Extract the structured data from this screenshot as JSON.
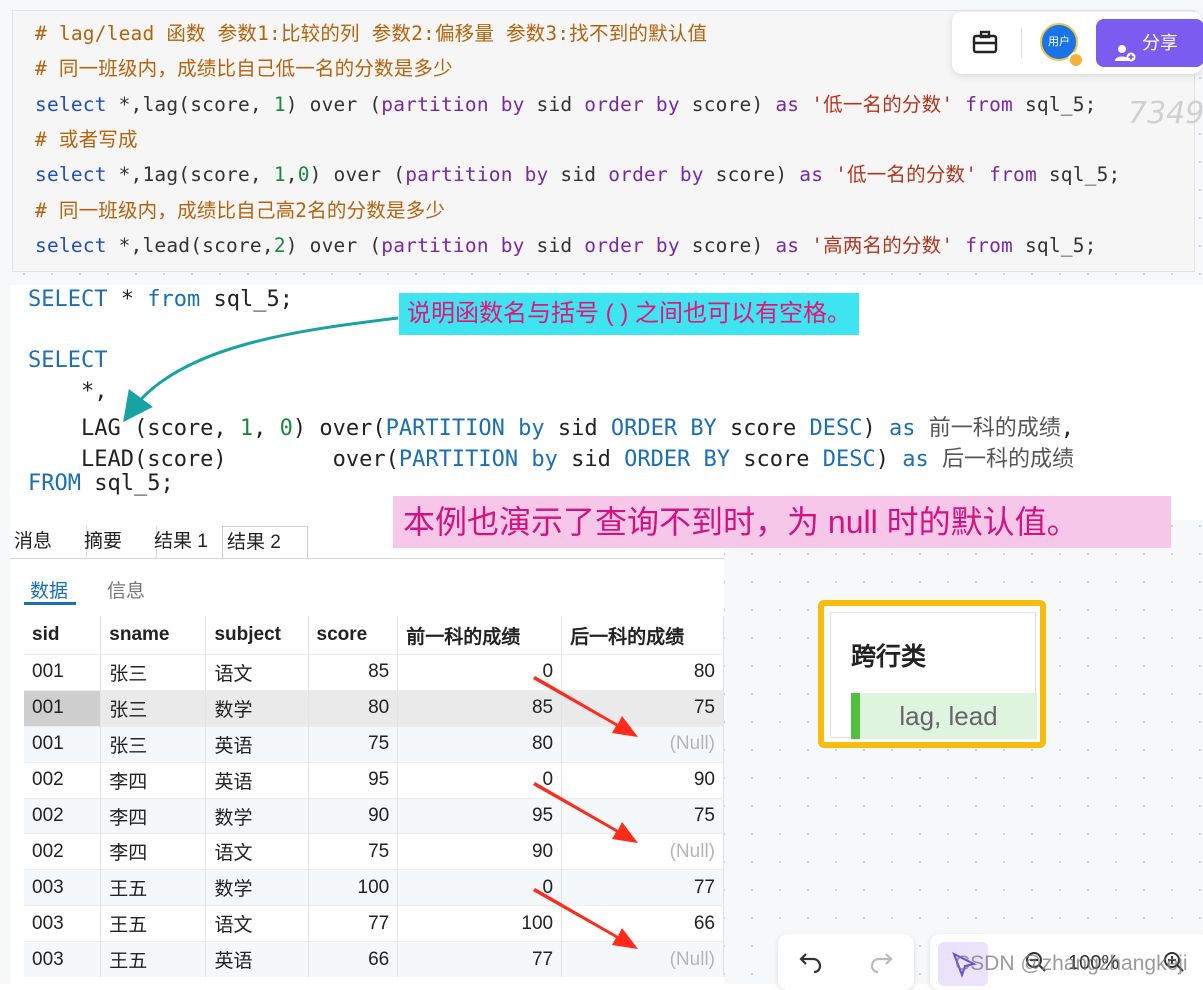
{
  "top_code": {
    "lines": [
      {
        "parts": [
          [
            "c-cmt",
            "# lag/lead 函数 参数1:比较的列 参数2:偏移量 参数3:找不到的默认值"
          ]
        ]
      },
      {
        "parts": [
          [
            "c-cmt",
            "# 同一班级内，成绩比自己低一名的分数是多少"
          ]
        ]
      },
      {
        "parts": [
          [
            "c-kw",
            "select"
          ],
          [
            "c-plain",
            " *,lag(score, "
          ],
          [
            "c-num",
            "1"
          ],
          [
            "c-plain",
            ") over ("
          ],
          [
            "c-purple",
            "partition by"
          ],
          [
            "c-plain",
            " sid "
          ],
          [
            "c-purple",
            "order by"
          ],
          [
            "c-plain",
            " score) "
          ],
          [
            "c-purple",
            "as"
          ],
          [
            "c-plain",
            " "
          ],
          [
            "c-str",
            "'低一名的分数'"
          ],
          [
            "c-plain",
            " "
          ],
          [
            "c-purple",
            "from"
          ],
          [
            "c-plain",
            " sql_5;"
          ]
        ]
      },
      {
        "parts": [
          [
            "c-cmt",
            "# 或者写成"
          ]
        ]
      },
      {
        "parts": [
          [
            "c-kw",
            "select"
          ],
          [
            "c-plain",
            " *,1ag(score, "
          ],
          [
            "c-num",
            "1"
          ],
          [
            "c-plain",
            ","
          ],
          [
            "c-num",
            "0"
          ],
          [
            "c-plain",
            ") over ("
          ],
          [
            "c-purple",
            "partition by"
          ],
          [
            "c-plain",
            " sid "
          ],
          [
            "c-purple",
            "order by"
          ],
          [
            "c-plain",
            " score) "
          ],
          [
            "c-purple",
            "as"
          ],
          [
            "c-plain",
            " "
          ],
          [
            "c-str",
            "'低一名的分数'"
          ],
          [
            "c-plain",
            " "
          ],
          [
            "c-purple",
            "from"
          ],
          [
            "c-plain",
            " sql_5;"
          ]
        ]
      },
      {
        "parts": [
          [
            "c-cmt",
            "# 同一班级内，成绩比自己高2名的分数是多少"
          ]
        ]
      },
      {
        "parts": [
          [
            "c-kw",
            "select"
          ],
          [
            "c-plain",
            " *,lead(score,"
          ],
          [
            "c-num",
            "2"
          ],
          [
            "c-plain",
            ") over ("
          ],
          [
            "c-purple",
            "partition by"
          ],
          [
            "c-plain",
            " sid "
          ],
          [
            "c-purple",
            "order by"
          ],
          [
            "c-plain",
            " score) "
          ],
          [
            "c-purple",
            "as"
          ],
          [
            "c-plain",
            " "
          ],
          [
            "c-str",
            "'高两名的分数'"
          ],
          [
            "c-plain",
            " "
          ],
          [
            "c-purple",
            "from"
          ],
          [
            "c-plain",
            " sql_5;"
          ]
        ]
      }
    ],
    "watermark": "7349"
  },
  "sql_block": {
    "lines": [
      {
        "parts": [
          [
            "c-blue2",
            "SELECT"
          ],
          [
            "c-dk",
            " * "
          ],
          [
            "c-blue2",
            "from"
          ],
          [
            "c-dk",
            " sql_5;"
          ]
        ]
      },
      {
        "parts": []
      },
      {
        "parts": [
          [
            "c-blue2",
            "SELECT"
          ]
        ]
      },
      {
        "parts": [
          [
            "c-dk",
            "    *,"
          ]
        ]
      },
      {
        "parts": [
          [
            "c-dk",
            "    LAG (score, "
          ],
          [
            "c-num",
            "1"
          ],
          [
            "c-dk",
            ", "
          ],
          [
            "c-num",
            "0"
          ],
          [
            "c-dk",
            ") over("
          ],
          [
            "c-blue2",
            "PARTITION"
          ],
          [
            "c-dk",
            " "
          ],
          [
            "c-blue2",
            "by"
          ],
          [
            "c-dk",
            " sid "
          ],
          [
            "c-blue2",
            "ORDER BY"
          ],
          [
            "c-dk",
            " score "
          ],
          [
            "c-blue2",
            "DESC"
          ],
          [
            "c-dk",
            ") "
          ],
          [
            "c-blue2",
            "as"
          ],
          [
            "c-dk",
            " "
          ],
          [
            "c-cn",
            "前一科的成绩"
          ],
          [
            "c-dk",
            ","
          ]
        ]
      },
      {
        "parts": [
          [
            "c-dk",
            "    LEAD(score)        over("
          ],
          [
            "c-blue2",
            "PARTITION"
          ],
          [
            "c-dk",
            " "
          ],
          [
            "c-blue2",
            "by"
          ],
          [
            "c-dk",
            " sid "
          ],
          [
            "c-blue2",
            "ORDER BY"
          ],
          [
            "c-dk",
            " score "
          ],
          [
            "c-blue2",
            "DESC"
          ],
          [
            "c-dk",
            ") "
          ],
          [
            "c-blue2",
            "as"
          ],
          [
            "c-dk",
            " "
          ],
          [
            "c-cn",
            "后一科的成绩"
          ]
        ]
      },
      {
        "parts": [
          [
            "c-blue2",
            "FROM"
          ],
          [
            "c-dk",
            " sql_5;"
          ]
        ]
      }
    ]
  },
  "annotations": {
    "note1": "说明函数名与括号 ( ) 之间也可以有空格。",
    "note2": "本例也演示了查询不到时，为 null 时的默认值。"
  },
  "toolbar": {
    "avatar_label": "用户",
    "share_label": "分享"
  },
  "result": {
    "tabs": [
      "消息",
      "摘要",
      "结果 1",
      "结果 2"
    ],
    "active_tab": "结果 2",
    "subtabs": {
      "data": "数据",
      "info": "信息"
    },
    "columns": [
      "sid",
      "sname",
      "subject",
      "score",
      "前一科的成绩",
      "后一科的成绩"
    ],
    "rows": [
      [
        "001",
        "张三",
        "语文",
        "85",
        "0",
        "80"
      ],
      [
        "001",
        "张三",
        "数学",
        "80",
        "85",
        "75"
      ],
      [
        "001",
        "张三",
        "英语",
        "75",
        "80",
        "(Null)"
      ],
      [
        "002",
        "李四",
        "英语",
        "95",
        "0",
        "90"
      ],
      [
        "002",
        "李四",
        "数学",
        "90",
        "95",
        "75"
      ],
      [
        "002",
        "李四",
        "语文",
        "75",
        "90",
        "(Null)"
      ],
      [
        "003",
        "王五",
        "数学",
        "100",
        "0",
        "77"
      ],
      [
        "003",
        "王五",
        "语文",
        "77",
        "100",
        "66"
      ],
      [
        "003",
        "王五",
        "英语",
        "66",
        "77",
        "(Null)"
      ]
    ]
  },
  "category_card": {
    "title": "跨行类",
    "tag": "lag, lead"
  },
  "bottom_bar": {
    "zoom": "100%",
    "watermark": "CSDN @zhangzhangkeji"
  },
  "colors": {
    "accent": "#7a5cf0",
    "note1_bg": "#3ee4f0",
    "note2_bg": "#f7c7ea",
    "card_border": "#f7bd0e",
    "arrow": "#ff2a1a"
  }
}
